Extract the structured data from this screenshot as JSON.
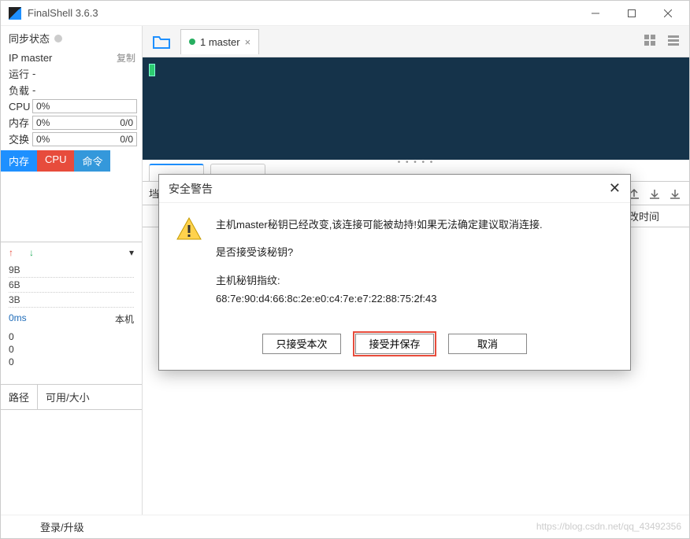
{
  "app": {
    "title": "FinalShell 3.6.3"
  },
  "sidebar": {
    "sync_label": "同步状态",
    "ip_label": "IP master",
    "copy_label": "复制",
    "run_label": "运行",
    "run_val": "-",
    "load_label": "负载",
    "load_val": "-",
    "cpu_label": "CPU",
    "cpu_val": "0%",
    "mem_label": "内存",
    "mem_val": "0%",
    "mem_total": "0/0",
    "swap_label": "交换",
    "swap_val": "0%",
    "swap_total": "0/0",
    "tabs": {
      "mem": "内存",
      "cpu": "CPU",
      "cmd": "命令"
    },
    "net_labels": [
      "9B",
      "6B",
      "3B"
    ],
    "latency": "0ms",
    "latency_loc": "本机",
    "zeros": [
      "0",
      "0",
      "0"
    ],
    "path_hdr": {
      "path": "路径",
      "avail": "可用/大小"
    }
  },
  "tabs": {
    "main": {
      "label": "1 master"
    }
  },
  "lower_toolbar": {
    "prefix": "垱"
  },
  "table": {
    "col_modtime": "修改时间"
  },
  "footer": {
    "login": "登录/升级"
  },
  "dialog": {
    "title": "安全警告",
    "line1": "主机master秘钥已经改变,该连接可能被劫持!如果无法确定建议取消连接.",
    "line2": "是否接受该秘钥?",
    "fp_label": "主机秘钥指纹:",
    "fingerprint": "68:7e:90:d4:66:8c:2e:e0:c4:7e:e7:22:88:75:2f:43",
    "btn_once": "只接受本次",
    "btn_save": "接受并保存",
    "btn_cancel": "取消"
  },
  "watermark": "https://blog.csdn.net/qq_43492356"
}
